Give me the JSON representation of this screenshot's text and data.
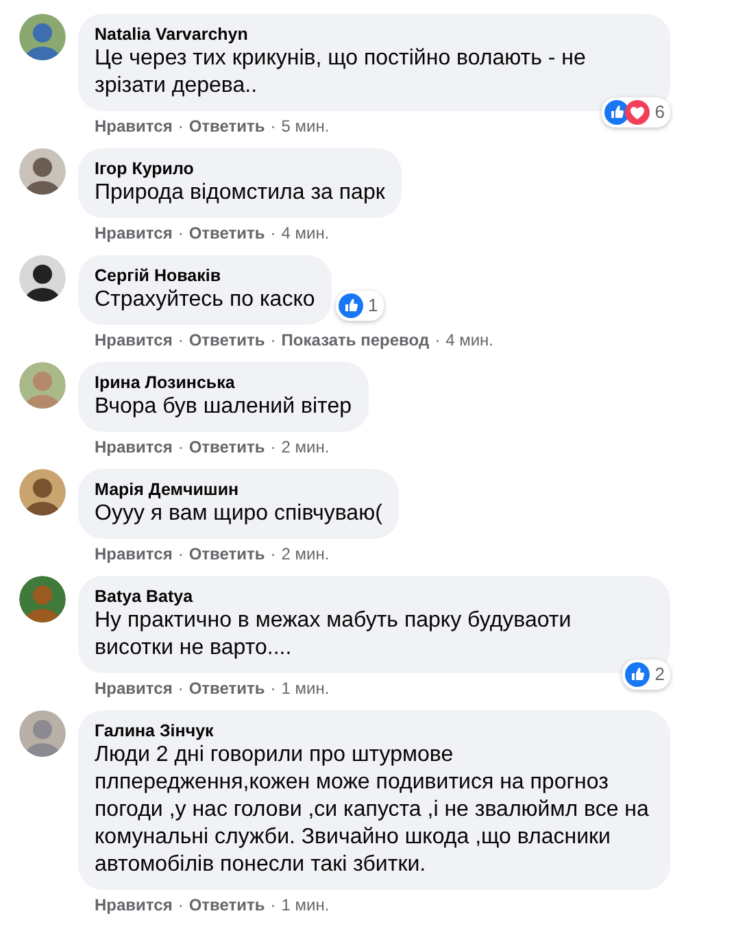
{
  "separator": "·",
  "comments": [
    {
      "author": "Natalia Varvarchyn",
      "text": "Це через тих крикунів, що постійно волають - не зрізати дерева..",
      "reactions": {
        "kind": "corner",
        "icons": [
          {
            "kind": "like"
          },
          {
            "kind": "love"
          }
        ],
        "count": "6"
      },
      "actions": [
        "Нравится",
        "Ответить"
      ],
      "time": "5 мин."
    },
    {
      "author": "Ігор Курило",
      "text": "Природа відомстила за парк",
      "actions": [
        "Нравится",
        "Ответить"
      ],
      "time": "4 мин."
    },
    {
      "author": "Сергій Новаків",
      "text": "Страхуйтесь по каско",
      "reactions": {
        "kind": "side",
        "icons": [
          {
            "kind": "like"
          }
        ],
        "count": "1"
      },
      "actions": [
        "Нравится",
        "Ответить",
        "Показать перевод"
      ],
      "time": "4 мин."
    },
    {
      "author": "Ірина Лозинська",
      "text": "Вчора був шалений вітер",
      "actions": [
        "Нравится",
        "Ответить"
      ],
      "time": "2 мин."
    },
    {
      "author": "Марія Демчишин",
      "text": "Оууу я вам щиро співчуваю(",
      "actions": [
        "Нравится",
        "Ответить"
      ],
      "time": "2 мин."
    },
    {
      "author": "Batya Batya",
      "text": "Ну практично в межах мабуть парку будуваоти висотки не варто....",
      "reactions": {
        "kind": "corner",
        "icons": [
          {
            "kind": "like"
          }
        ],
        "count": "2"
      },
      "actions": [
        "Нравится",
        "Ответить"
      ],
      "time": "1 мин."
    },
    {
      "author": "Галина Зінчук",
      "text": "Люди 2 дні говорили про штурмове плпередження,кожен може подивитися на прогноз погоди ,у нас голови ,си капуста ,і не звалюймл все на комунальні служби. Звичайно шкода ,що власники автомобілів понесли такі збитки.",
      "actions": [
        "Нравится",
        "Ответить"
      ],
      "time": "1 мин."
    }
  ]
}
